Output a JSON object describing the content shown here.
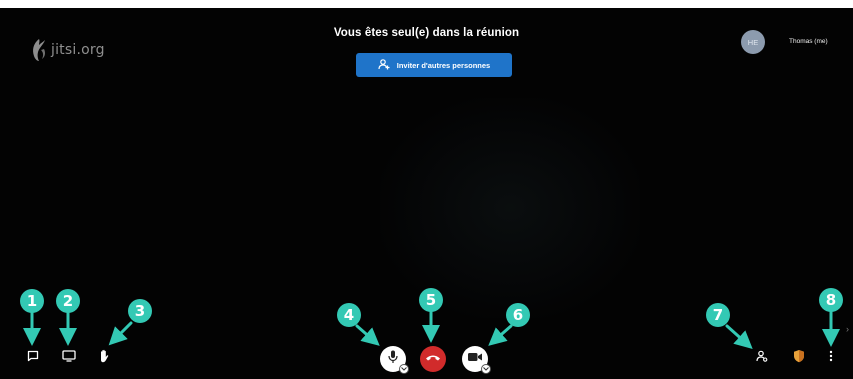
{
  "header": {
    "logo_text": "jitsi.org",
    "alone_title": "Vous êtes seul(e) dans la réunion",
    "invite_button_label": "Inviter d'autres personnes"
  },
  "participant": {
    "avatar_initials": "HE",
    "name": "Thomas (me)"
  },
  "toolbar": {
    "left": [
      {
        "icon": "chat-icon"
      },
      {
        "icon": "screen-share-icon"
      },
      {
        "icon": "raise-hand-icon"
      }
    ],
    "center": [
      {
        "icon": "microphone-icon"
      },
      {
        "icon": "hangup-icon",
        "color": "#d12b2b"
      },
      {
        "icon": "camera-icon"
      }
    ],
    "right": [
      {
        "icon": "participants-icon"
      },
      {
        "icon": "security-shield-icon",
        "color": "#e8a13a"
      },
      {
        "icon": "more-options-icon"
      }
    ]
  },
  "callouts": [
    "1",
    "2",
    "3",
    "4",
    "5",
    "6",
    "7",
    "8"
  ],
  "colors": {
    "background": "#030303",
    "invite_button": "#1f74c9",
    "callout": "#33c9b4",
    "hangup": "#d12b2b",
    "shield": "#e8a13a"
  }
}
